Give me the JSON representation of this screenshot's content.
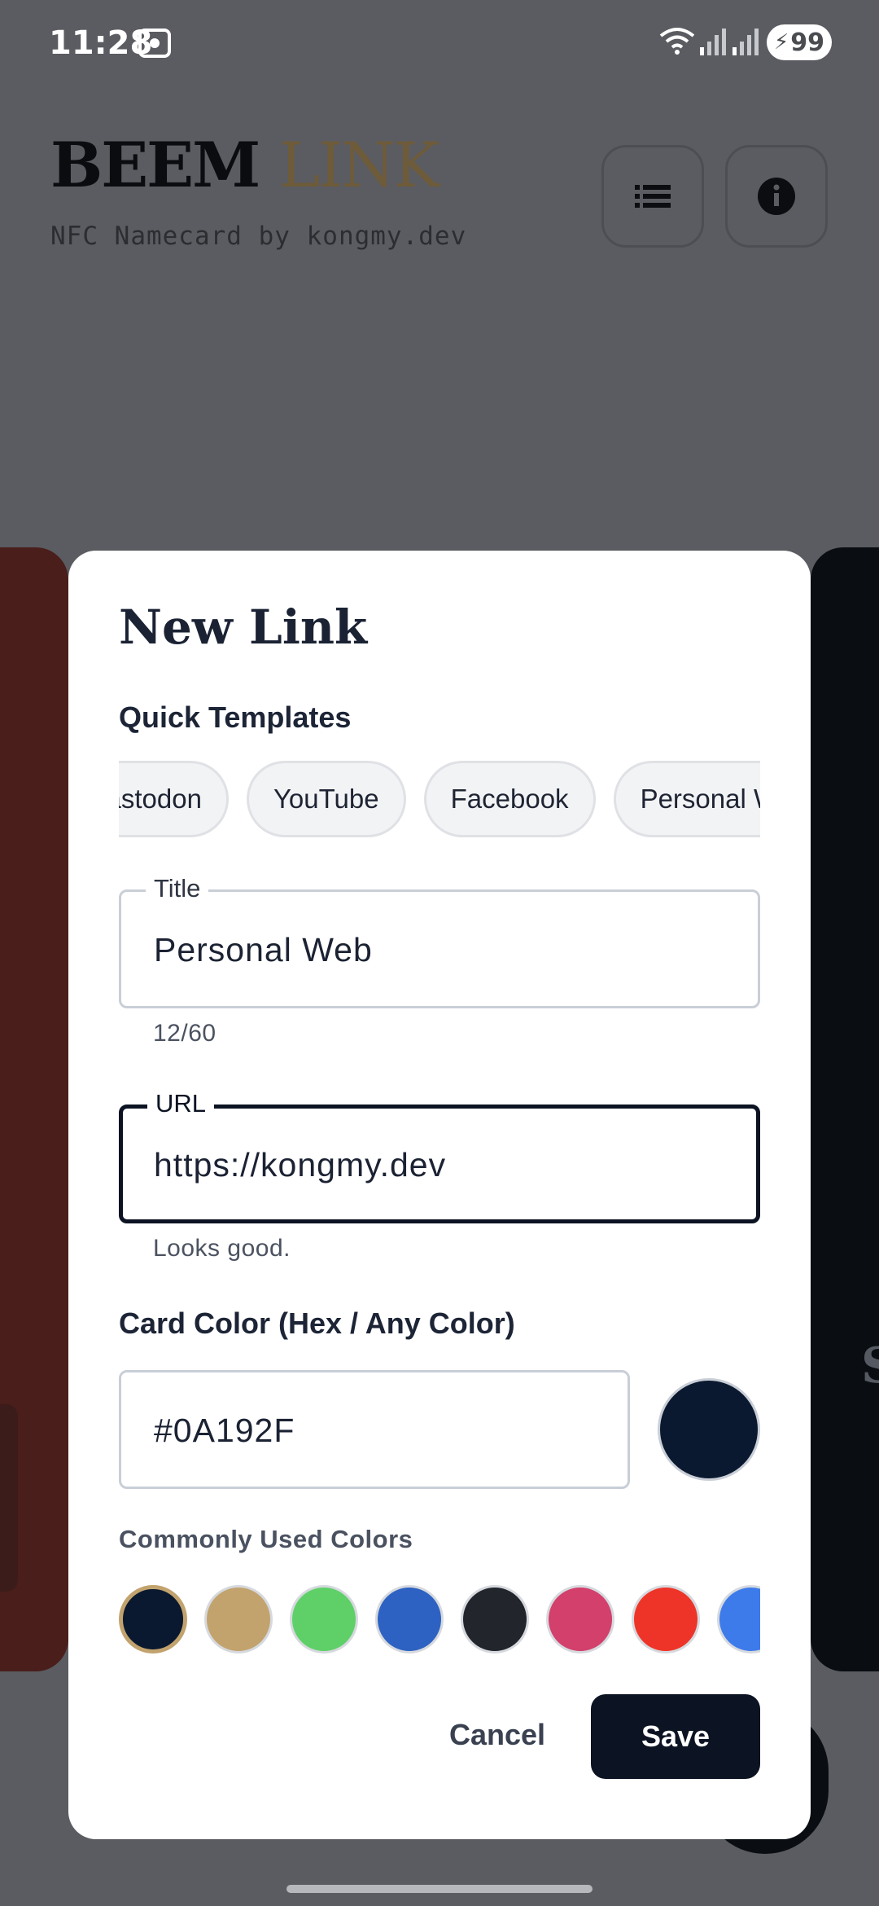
{
  "status_bar": {
    "time": "11:28",
    "battery": "99"
  },
  "header": {
    "brand_primary": "BEEM",
    "brand_secondary": "LINK",
    "tagline": "NFC Namecard by kongmy.dev",
    "list_button_icon": "list-icon",
    "info_button_icon": "info-icon"
  },
  "background": {
    "right_card_peek": "S"
  },
  "dialog": {
    "title": "New Link",
    "quick_templates_label": "Quick Templates",
    "templates": [
      "Mastodon",
      "YouTube",
      "Facebook",
      "Personal Web"
    ],
    "title_field": {
      "label": "Title",
      "value": "Personal Web",
      "counter": "12/60"
    },
    "url_field": {
      "label": "URL",
      "value": "https://kongmy.dev",
      "helper": "Looks good."
    },
    "card_color_label": "Card Color (Hex / Any Color)",
    "hex_value": "#0A192F",
    "preview_color": "#0A192F",
    "common_colors_label": "Commonly Used Colors",
    "swatches": [
      "#0A192F",
      "#C2A36E",
      "#5FD068",
      "#2D62C2",
      "#22252B",
      "#D2406B",
      "#EE3428",
      "#3D7BEA"
    ],
    "selected_swatch": "#0A192F",
    "cancel_label": "Cancel",
    "save_label": "Save"
  }
}
